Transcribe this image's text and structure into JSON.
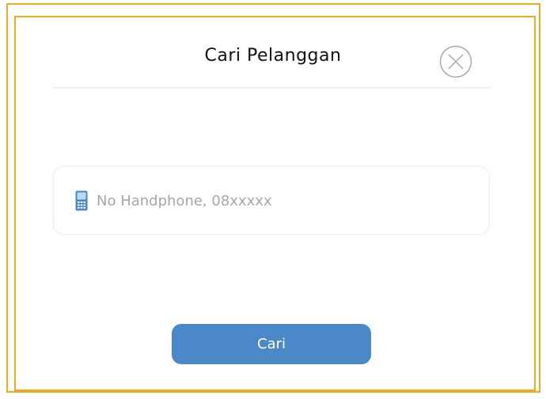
{
  "dialog": {
    "title": "Cari Pelanggan",
    "close_icon": "close-circle-icon"
  },
  "phone_field": {
    "icon": "mobile-phone-icon",
    "value": "",
    "placeholder": "No Handphone, 08xxxxx"
  },
  "actions": {
    "search_label": "Cari"
  },
  "colors": {
    "frame_border": "#F5A623",
    "button_bg": "#4A88C8",
    "phone_icon": "#4A88C8",
    "placeholder": "#A6A6A6",
    "title": "#111111"
  }
}
